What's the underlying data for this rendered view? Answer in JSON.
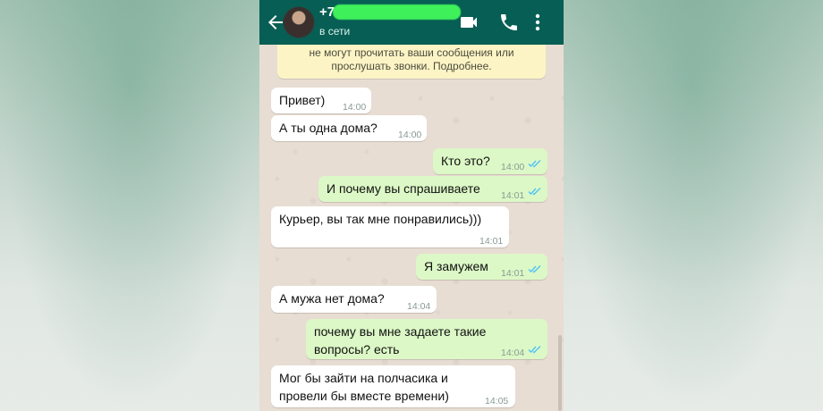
{
  "header": {
    "contact_name": "+7",
    "status": "в сети",
    "icons": [
      "back-arrow-icon",
      "avatar",
      "video-call-icon",
      "phone-call-icon",
      "more-vertical-icon"
    ]
  },
  "notice": {
    "line1": "не могут прочитать ваши сообщения или",
    "line2": "прослушать звонки. Подробнее."
  },
  "messages": [
    {
      "dir": "in",
      "text": "Привет)",
      "time": "14:00"
    },
    {
      "dir": "in",
      "text": "А ты одна дома?",
      "time": "14:00"
    },
    {
      "dir": "out",
      "text": "Кто это?",
      "time": "14:00"
    },
    {
      "dir": "out",
      "text": "И почему вы спрашиваете",
      "time": "14:01"
    },
    {
      "dir": "in",
      "text": "Курьер, вы так мне понравились)))",
      "time": "14:01"
    },
    {
      "dir": "out",
      "text": "Я замужем",
      "time": "14:01"
    },
    {
      "dir": "in",
      "text": "А мужа нет дома?",
      "time": "14:04"
    },
    {
      "dir": "out",
      "lines": [
        "почему вы мне задаете такие",
        "вопросы? есть"
      ],
      "time": "14:04"
    },
    {
      "dir": "in",
      "lines": [
        "Мог бы зайти на полчасика и",
        "провели бы вместе времени)"
      ],
      "time": "14:05"
    }
  ],
  "colors": {
    "header": "#075e54",
    "incoming": "#ffffff",
    "outgoing": "#dcf8c6",
    "read_ticks": "#4fc3f7",
    "redaction": "#3ef05a"
  }
}
